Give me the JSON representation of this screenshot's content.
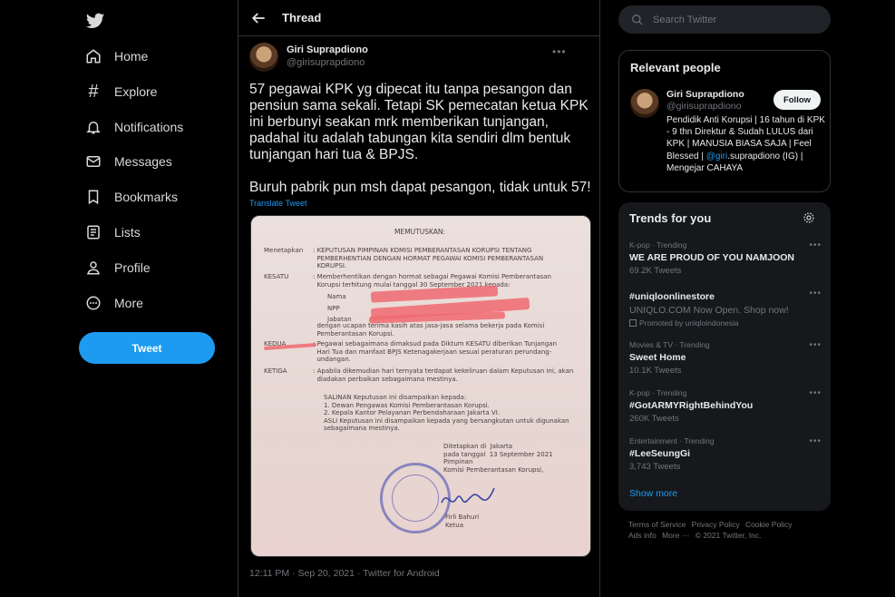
{
  "nav": {
    "items": [
      {
        "label": "Home",
        "icon": "home-icon"
      },
      {
        "label": "Explore",
        "icon": "hashtag-icon"
      },
      {
        "label": "Notifications",
        "icon": "bell-icon"
      },
      {
        "label": "Messages",
        "icon": "envelope-icon"
      },
      {
        "label": "Bookmarks",
        "icon": "bookmark-icon"
      },
      {
        "label": "Lists",
        "icon": "list-icon"
      },
      {
        "label": "Profile",
        "icon": "person-icon"
      },
      {
        "label": "More",
        "icon": "more-circle-icon"
      }
    ],
    "tweet_button": "Tweet"
  },
  "thread": {
    "title": "Thread",
    "author_name": "Giri Suprapdiono",
    "author_handle": "@girisuprapdiono",
    "text": "57 pegawai KPK yg dipecat itu tanpa pesangon dan pensiun sama sekali. Tetapi SK pemecatan ketua KPK ini berbunyi seakan mrk memberikan tunjangan, padahal itu adalah tabungan kita sendiri dlm bentuk tunjangan hari tua & BPJS.\n\nBuruh pabrik pun msh dapat pesangon, tidak untuk 57!",
    "translate": "Translate Tweet",
    "timestamp": "12:11 PM · Sep 20, 2021 · Twitter for Android",
    "document": {
      "heading": "MEMUTUSKAN:",
      "menetapkan_label": "Menetapkan",
      "menetapkan_text": ": KEPUTUSAN PIMPINAN KOMISI PEMBERANTASAN KORUPSI TENTANG\n  PEMBERHENTIAN DENGAN HORMAT PEGAWAI KOMISI PEMBERANTASAN\n  KORUPSI.",
      "kesatu_label": "KESATU",
      "kesatu_text": ": Memberhentikan dengan hormat sebagai Pegawai Komisi Pemberantasan\n  Korupsi terhitung mulai tanggal 30 September 2021 kepada:",
      "nama_label": "Nama",
      "npp_label": "NPP",
      "jabatan_label": "Jabatan",
      "kesatu_tail": "  dengan ucapan terima kasih atas jasa-jasa selama bekerja pada Komisi\n  Pemberantasan Korupsi.",
      "kedua_label": "KEDUA",
      "kedua_text": ": Pegawai sebagaimana dimaksud pada Diktum KESATU diberikan Tunjangan\n  Hari Tua dan manfaat BPJS Ketenagakerjaan sesuai peraturan perundang-\n  undangan.",
      "ketiga_label": "KETIGA",
      "ketiga_text": ": Apabila dikemudian hari ternyata terdapat kekeliruan dalam Keputusan ini, akan\n  diadakan perbaikan sebagaimana mestinya.",
      "salinan_text": "SALINAN Keputusan ini disampaikan kepada:\n1. Dewan Pengawas Komisi Pemberantasan Korupsi.\n2. Kepala Kantor Pelayanan Perbendaharaan Jakarta VI.\nASLI Keputusan ini disampaikan kepada yang bersangkutan untuk digunakan\nsebagaimana mestinya.",
      "ditetapkan_text": "Ditetapkan di  Jakarta\npada tanggal  13 September 2021\nPimpinan\nKomisi Pemberantasan Korupsi,",
      "signer": "Firli Bahuri\nKetua"
    }
  },
  "search": {
    "placeholder": "Search Twitter"
  },
  "relevant": {
    "title": "Relevant people",
    "name": "Giri Suprapdiono",
    "handle": "@girisuprapdiono",
    "follow": "Follow",
    "bio_before": "Pendidik Anti Korupsi | 16 tahun di KPK - 9 thn Direktur & Sudah LULUS dari KPK | MANUSIA BIASA SAJA | Feel Blessed | ",
    "bio_link": "@giri",
    "bio_after": ".suprapdiono (IG) | Mengejar CAHAYA"
  },
  "trends": {
    "title": "Trends for you",
    "items": [
      {
        "meta": "K-pop · Trending",
        "name": "WE ARE PROUD OF YOU NAMJOON",
        "sub": "69.2K Tweets"
      },
      {
        "meta": "",
        "name": "#uniqloonlinestore",
        "sub": "UNIQLO.COM Now Open. Shop now!",
        "promoted": "Promoted by uniqloindonesia"
      },
      {
        "meta": "Movies & TV · Trending",
        "name": "Sweet Home",
        "sub": "10.1K Tweets"
      },
      {
        "meta": "K-pop · Trending",
        "name": "#GotARMYRightBehindYou",
        "sub": "260K Tweets"
      },
      {
        "meta": "Entertainment · Trending",
        "name": "#LeeSeungGi",
        "sub": "3,743 Tweets"
      }
    ],
    "show_more": "Show more"
  },
  "footer": {
    "links": [
      "Terms of Service",
      "Privacy Policy",
      "Cookie Policy",
      "Ads info",
      "More ···"
    ],
    "copyright": "© 2021 Twitter, Inc."
  }
}
